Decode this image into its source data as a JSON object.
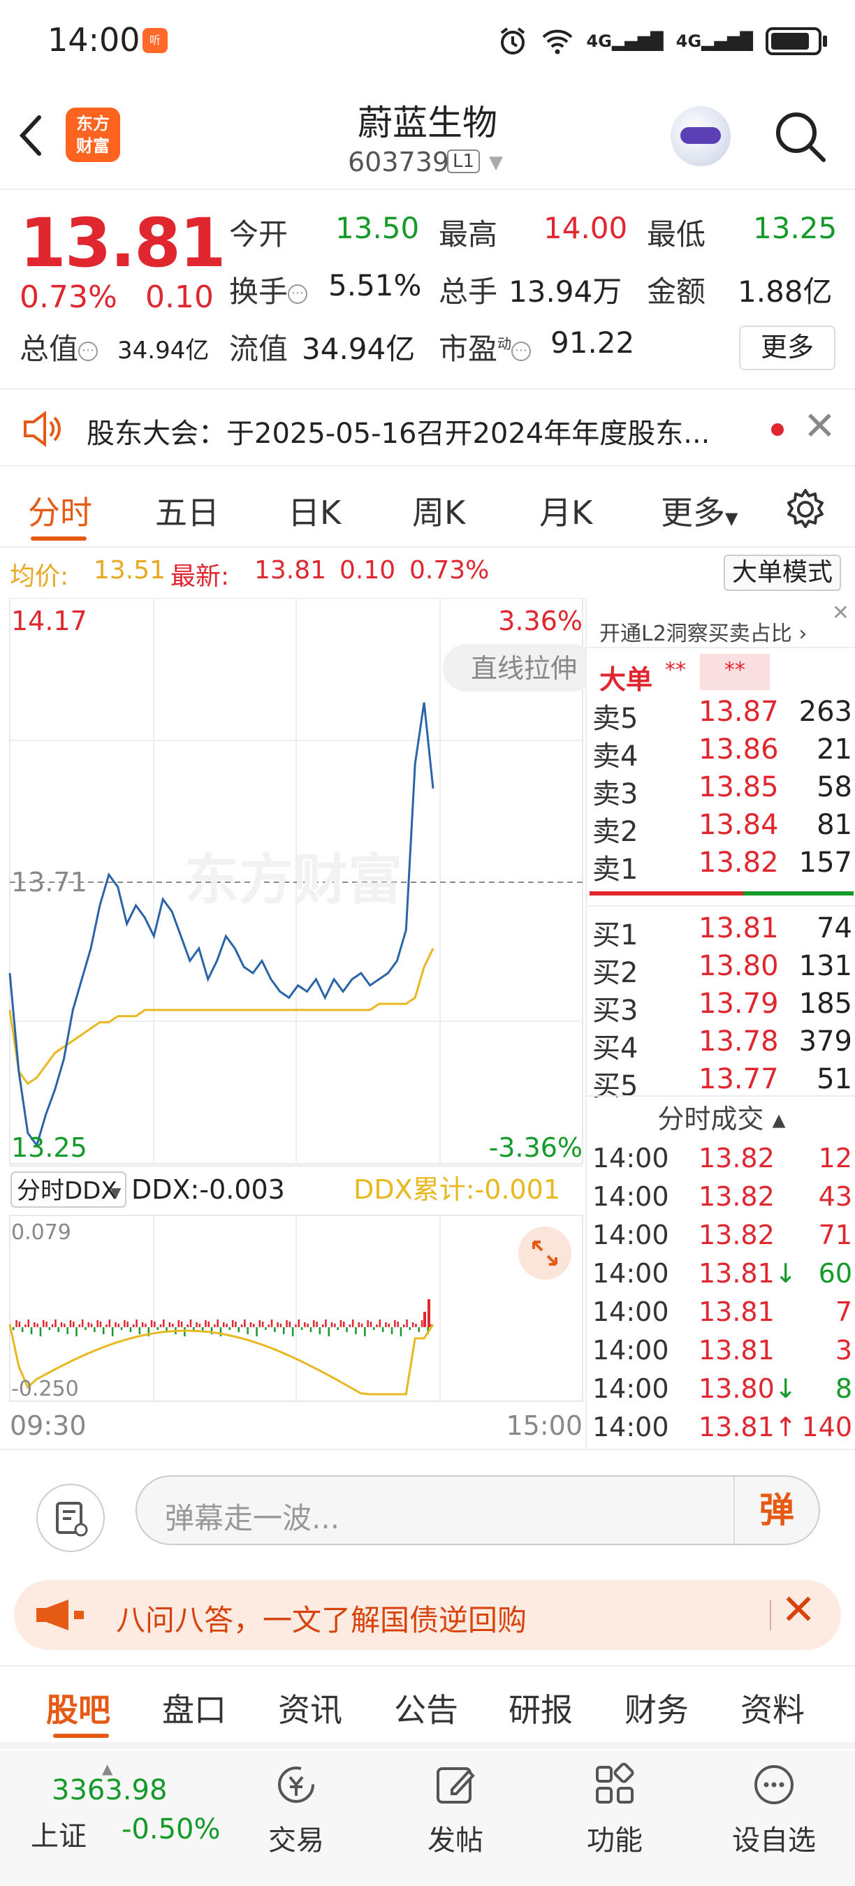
{
  "status": {
    "time": "14:00",
    "badge": "听",
    "net1": "4G",
    "net2": "4G"
  },
  "header": {
    "stock_name": "蔚蓝生物",
    "stock_code": "603739",
    "level": "L1",
    "logo": "东方财富"
  },
  "quote": {
    "price": "13.81",
    "change_pct": "0.73%",
    "change_amt": "0.10",
    "open_label": "今开",
    "open": "13.50",
    "high_label": "最高",
    "high": "14.00",
    "low_label": "最低",
    "low": "13.25",
    "turnover_label": "换手",
    "turnover": "5.51%",
    "volume_label": "总手",
    "volume": "13.94万",
    "amount_label": "金额",
    "amount": "1.88亿",
    "mktcap_label": "总值",
    "mktcap": "34.94亿",
    "float_label": "流值",
    "float": "34.94亿",
    "pe_label": "市盈",
    "pe_sup": "动",
    "pe": "91.22",
    "more": "更多"
  },
  "notice": {
    "text": "股东大会：于2025-05-16召开2024年年度股东..."
  },
  "chart_tabs": [
    "分时",
    "五日",
    "日K",
    "周K",
    "月K",
    "更多"
  ],
  "avg_row": {
    "avg_label": "均价:",
    "avg": "13.51",
    "latest_label": "最新:",
    "latest": "13.81",
    "chg": "0.10",
    "chg_pct": "0.73%",
    "mode_button": "大单模式"
  },
  "chart": {
    "top_price": "14.17",
    "top_pct": "3.36%",
    "bottom_price": "13.25",
    "bottom_pct": "-3.36%",
    "mid_price": "13.71",
    "straight_pull": "直线拉伸",
    "watermark": "东方财富",
    "ddx_selector": "分时DDX",
    "ddx": "DDX:-0.003",
    "ddx_cum": "DDX累计:-0.001",
    "ddx_top": "0.079",
    "ddx_bottom": "-0.250",
    "time_start": "09:30",
    "time_end": "15:00",
    "colors": {
      "price_line": "#2a64a8",
      "avg_line": "#e8b820",
      "up": "#e0262f",
      "down": "#149a28"
    }
  },
  "chart_data": {
    "type": "line",
    "ylim": [
      13.25,
      14.17
    ],
    "series": [
      {
        "values": [
          13.56,
          13.4,
          13.3,
          13.28,
          13.33,
          13.37,
          13.42,
          13.5,
          13.55,
          13.6,
          13.67,
          13.72,
          13.7,
          13.64,
          13.67,
          13.65,
          13.62,
          13.68,
          13.66,
          13.62,
          13.58,
          13.6,
          13.55,
          13.58,
          13.62,
          13.6,
          13.57,
          13.56,
          13.58,
          13.55,
          13.53,
          13.52,
          13.54,
          13.53,
          13.55,
          13.52,
          13.55,
          13.53,
          13.55,
          13.56,
          13.54,
          13.55,
          13.56,
          13.58,
          13.63,
          13.9,
          14.0,
          13.86
        ]
      },
      {
        "values": [
          13.5,
          13.4,
          13.38,
          13.39,
          13.41,
          13.43,
          13.44,
          13.45,
          13.46,
          13.47,
          13.48,
          13.48,
          13.49,
          13.49,
          13.49,
          13.5,
          13.5,
          13.5,
          13.5,
          13.5,
          13.5,
          13.5,
          13.5,
          13.5,
          13.5,
          13.5,
          13.5,
          13.5,
          13.5,
          13.5,
          13.5,
          13.5,
          13.5,
          13.5,
          13.5,
          13.5,
          13.5,
          13.5,
          13.5,
          13.5,
          13.5,
          13.51,
          13.51,
          13.51,
          13.51,
          13.52,
          13.57,
          13.6
        ]
      }
    ]
  },
  "order_book": {
    "l2_banner": "开通L2洞察买卖占比 ›",
    "big_label": "大单",
    "big_val1": "**",
    "big_val2": "**",
    "sells": [
      {
        "label": "卖5",
        "price": "13.87",
        "vol": "263"
      },
      {
        "label": "卖4",
        "price": "13.86",
        "vol": "21"
      },
      {
        "label": "卖3",
        "price": "13.85",
        "vol": "58"
      },
      {
        "label": "卖2",
        "price": "13.84",
        "vol": "81"
      },
      {
        "label": "卖1",
        "price": "13.82",
        "vol": "157"
      }
    ],
    "buys": [
      {
        "label": "买1",
        "price": "13.81",
        "vol": "74"
      },
      {
        "label": "买2",
        "price": "13.80",
        "vol": "131"
      },
      {
        "label": "买3",
        "price": "13.79",
        "vol": "185"
      },
      {
        "label": "买4",
        "price": "13.78",
        "vol": "379"
      },
      {
        "label": "买5",
        "price": "13.77",
        "vol": "51"
      }
    ],
    "trades_header": "分时成交 ▴",
    "trades": [
      {
        "time": "14:00",
        "price": "13.82",
        "arrow": "",
        "vol": "12",
        "dir": "up"
      },
      {
        "time": "14:00",
        "price": "13.82",
        "arrow": "",
        "vol": "43",
        "dir": "up"
      },
      {
        "time": "14:00",
        "price": "13.82",
        "arrow": "",
        "vol": "71",
        "dir": "up"
      },
      {
        "time": "14:00",
        "price": "13.81",
        "arrow": "↓",
        "vol": "60",
        "dir": "down"
      },
      {
        "time": "14:00",
        "price": "13.81",
        "arrow": "",
        "vol": "7",
        "dir": "up"
      },
      {
        "time": "14:00",
        "price": "13.81",
        "arrow": "",
        "vol": "3",
        "dir": "up"
      },
      {
        "time": "14:00",
        "price": "13.80",
        "arrow": "↓",
        "vol": "8",
        "dir": "down"
      },
      {
        "time": "14:00",
        "price": "13.81",
        "arrow": "↑",
        "vol": "140",
        "dir": "up"
      }
    ]
  },
  "danmu": {
    "placeholder": "弹幕走一波...",
    "send": "弹"
  },
  "promo": {
    "text": "八问八答，一文了解国债逆回购"
  },
  "section_tabs": [
    "股吧",
    "盘口",
    "资讯",
    "公告",
    "研报",
    "财务",
    "资料"
  ],
  "bottom_nav": {
    "index_value": "3363.98",
    "index_name": "上证",
    "index_change": "-0.50%",
    "items": [
      "交易",
      "发帖",
      "功能",
      "设自选"
    ]
  }
}
